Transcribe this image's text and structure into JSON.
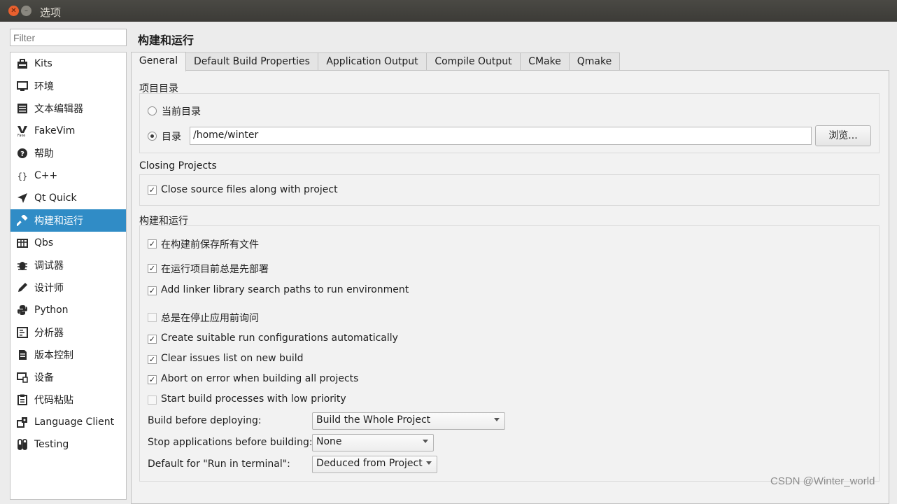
{
  "window": {
    "title": "选项"
  },
  "filter": {
    "placeholder": "Filter"
  },
  "sidebar": {
    "items": [
      {
        "label": "Kits",
        "icon": "kits-icon"
      },
      {
        "label": "环境",
        "icon": "monitor-icon"
      },
      {
        "label": "文本编辑器",
        "icon": "text-editor-icon"
      },
      {
        "label": "FakeVim",
        "icon": "fakevim-icon"
      },
      {
        "label": "帮助",
        "icon": "help-icon"
      },
      {
        "label": "C++",
        "icon": "braces-icon"
      },
      {
        "label": "Qt Quick",
        "icon": "qtquick-icon"
      },
      {
        "label": "构建和运行",
        "icon": "hammer-icon"
      },
      {
        "label": "Qbs",
        "icon": "qbs-icon"
      },
      {
        "label": "调试器",
        "icon": "bug-icon"
      },
      {
        "label": "设计师",
        "icon": "pencil-icon"
      },
      {
        "label": "Python",
        "icon": "python-icon"
      },
      {
        "label": "分析器",
        "icon": "analyzer-icon"
      },
      {
        "label": "版本控制",
        "icon": "version-control-icon"
      },
      {
        "label": "设备",
        "icon": "device-icon"
      },
      {
        "label": "代码粘贴",
        "icon": "clipboard-icon"
      },
      {
        "label": "Language Client",
        "icon": "language-client-icon"
      },
      {
        "label": "Testing",
        "icon": "testing-icon"
      }
    ],
    "selected": "构建和运行",
    "accent_color": "#308cc6"
  },
  "page": {
    "title": "构建和运行"
  },
  "tabs": [
    "General",
    "Default Build Properties",
    "Application Output",
    "Compile Output",
    "CMake",
    "Qmake"
  ],
  "active_tab": "General",
  "project_dir": {
    "group_label": "项目目录",
    "current_dir_label": "当前目录",
    "dir_label": "目录",
    "dir_value": "/home/winter",
    "browse_label": "浏览...",
    "selected": "目录"
  },
  "closing": {
    "group_label": "Closing Projects",
    "close_files_label": "Close source files along with project",
    "close_files_checked": true
  },
  "build_run": {
    "group_label": "构建和运行",
    "options": [
      {
        "label": "在构建前保存所有文件",
        "checked": true
      },
      {
        "label": "在运行项目前总是先部署",
        "checked": true
      },
      {
        "label": "Add linker library search paths to run environment",
        "checked": true
      },
      {
        "label": "总是在停止应用前询问",
        "checked": false
      },
      {
        "label": "Create suitable run configurations automatically",
        "checked": true
      },
      {
        "label": "Clear issues list on new build",
        "checked": true
      },
      {
        "label": "Abort on error when building all projects",
        "checked": true
      },
      {
        "label": "Start build processes with low priority",
        "checked": false
      }
    ],
    "build_before_deploying_label": "Build before deploying:",
    "build_before_deploying_value": "Build the Whole Project",
    "stop_apps_label": "Stop applications before building:",
    "stop_apps_value": "None",
    "run_in_terminal_label": "Default for \"Run in terminal\":",
    "run_in_terminal_value": "Deduced from Project"
  },
  "watermark": "CSDN @Winter_world"
}
